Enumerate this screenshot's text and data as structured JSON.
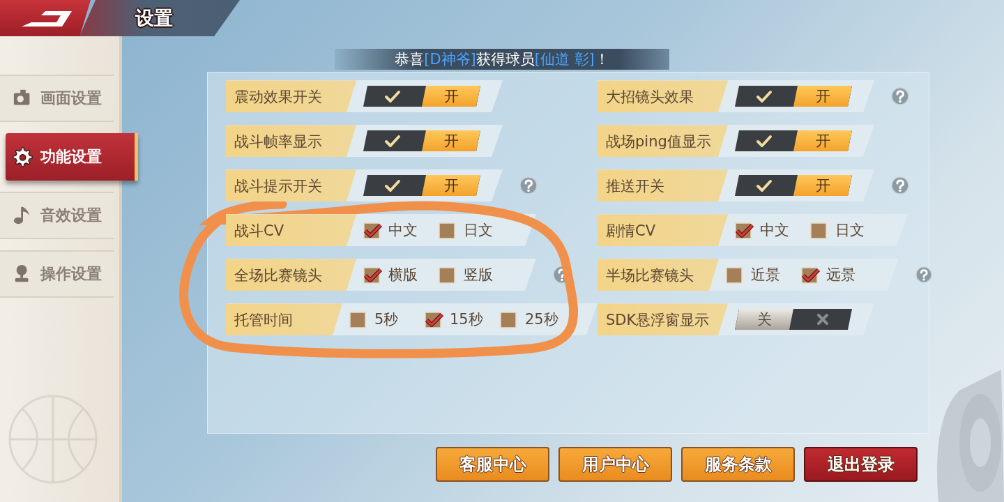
{
  "header": {
    "title": "设置"
  },
  "sidebar": {
    "items": [
      {
        "label": "画面设置",
        "selected": false
      },
      {
        "label": "功能设置",
        "selected": true
      },
      {
        "label": "音效设置",
        "selected": false
      },
      {
        "label": "操作设置",
        "selected": false
      }
    ]
  },
  "notice": {
    "segments": [
      {
        "text": "恭喜",
        "kind": "plain"
      },
      {
        "text": "[D神爷]",
        "kind": "highlight"
      },
      {
        "text": "获得球员",
        "kind": "plain"
      },
      {
        "text": "[仙道 彰]",
        "kind": "highlight"
      },
      {
        "text": "！",
        "kind": "plain"
      }
    ]
  },
  "settings": [
    {
      "label": "震动效果开关",
      "kind": "toggle",
      "on": true,
      "text": "开",
      "help": false
    },
    {
      "label": "大招镜头效果",
      "kind": "toggle",
      "on": true,
      "text": "开",
      "help": true
    },
    {
      "label": "战斗帧率显示",
      "kind": "toggle",
      "on": true,
      "text": "开",
      "help": false
    },
    {
      "label": "战场ping值显示",
      "kind": "toggle",
      "on": true,
      "text": "开",
      "help": false
    },
    {
      "label": "战斗提示开关",
      "kind": "toggle",
      "on": true,
      "text": "开",
      "help": true
    },
    {
      "label": "推送开关",
      "kind": "toggle",
      "on": true,
      "text": "开",
      "help": true
    },
    {
      "label": "战斗CV",
      "kind": "choice",
      "options": [
        {
          "label": "中文",
          "checked": true
        },
        {
          "label": "日文",
          "checked": false
        }
      ],
      "help": false
    },
    {
      "label": "剧情CV",
      "kind": "choice",
      "options": [
        {
          "label": "中文",
          "checked": true
        },
        {
          "label": "日文",
          "checked": false
        }
      ],
      "help": false
    },
    {
      "label": "全场比赛镜头",
      "kind": "choice",
      "options": [
        {
          "label": "横版",
          "checked": true
        },
        {
          "label": "竖版",
          "checked": false
        }
      ],
      "help": true
    },
    {
      "label": "半场比赛镜头",
      "kind": "choice",
      "options": [
        {
          "label": "近景",
          "checked": false
        },
        {
          "label": "远景",
          "checked": true
        }
      ],
      "help": true
    },
    {
      "label": "托管时间",
      "kind": "choice",
      "options": [
        {
          "label": "5秒",
          "checked": false
        },
        {
          "label": "15秒",
          "checked": true
        },
        {
          "label": "25秒",
          "checked": false
        }
      ],
      "help": false
    },
    {
      "label": "SDK悬浮窗显示",
      "kind": "toggle",
      "on": false,
      "text": "关",
      "help": false
    }
  ],
  "buttons": [
    {
      "label": "客服中心",
      "kind": "primary"
    },
    {
      "label": "用户中心",
      "kind": "primary"
    },
    {
      "label": "服务条款",
      "kind": "primary"
    },
    {
      "label": "退出登录",
      "kind": "danger"
    }
  ]
}
